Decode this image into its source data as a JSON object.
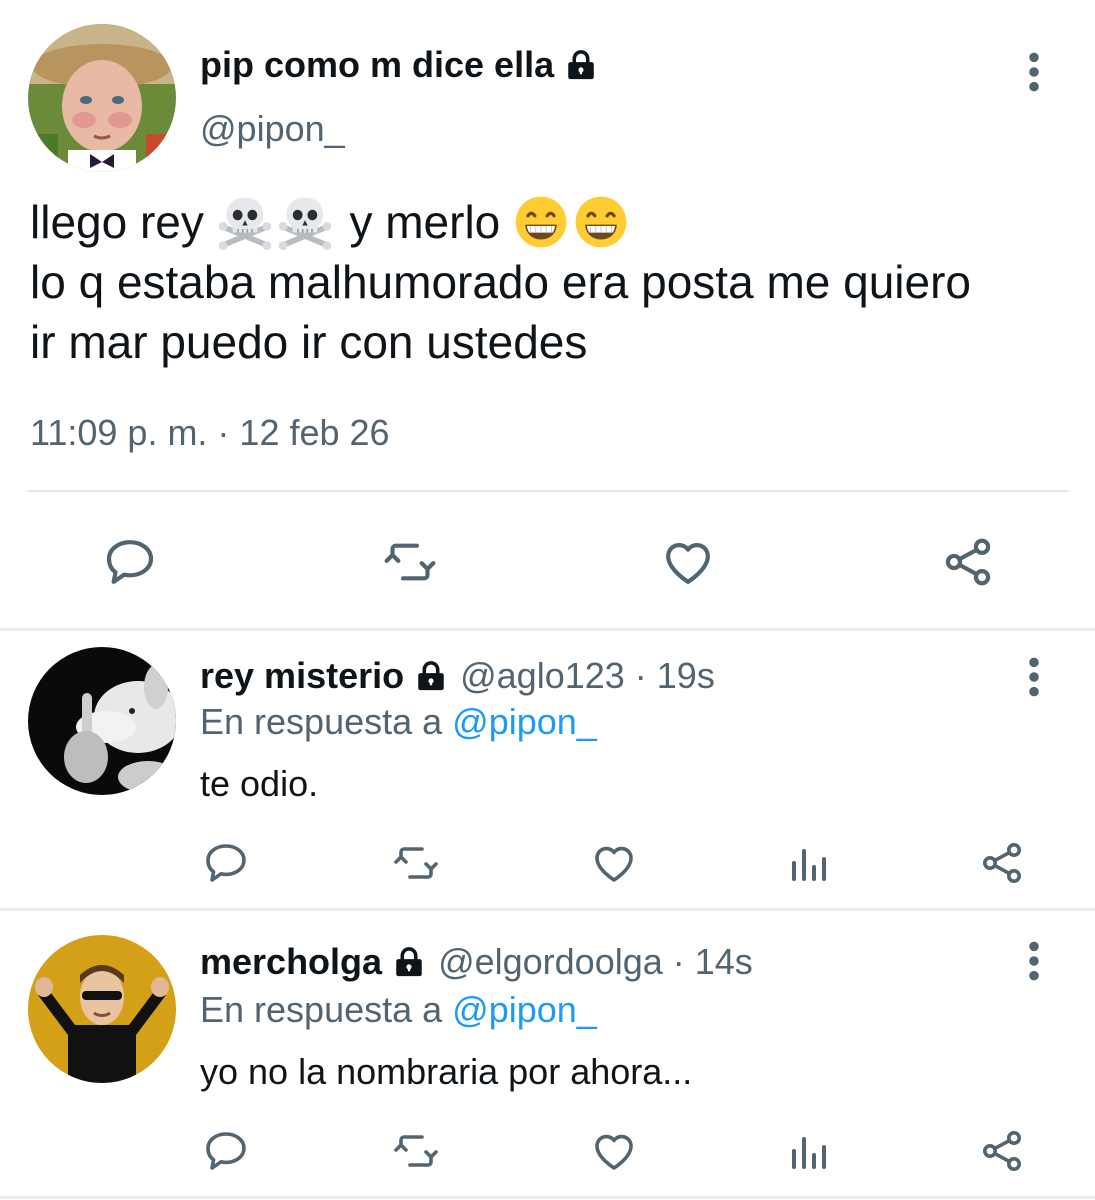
{
  "main_tweet": {
    "display_name": "pip como m dice ella",
    "handle": "@pipon_",
    "text_line1_a": "llego rey",
    "text_line1_b": "y merlo",
    "text_line2": "lo q estaba malhumorado era posta me quiero",
    "text_line3": "ir mar puedo ir con ustedes",
    "emojis_1": [
      "skull-crossbones",
      "skull-crossbones"
    ],
    "emojis_2": [
      "grinning-face",
      "grinning-face"
    ],
    "timestamp": "11:09 p. m. · 12 feb 26",
    "actions": [
      "reply-icon",
      "retweet-icon",
      "like-icon",
      "share-icon"
    ]
  },
  "replies": [
    {
      "display_name": "rey misterio",
      "meta": "@aglo123 · 19s",
      "reply_prefix": "En respuesta a ",
      "reply_mention": "@pipon_",
      "text": "te odio.",
      "actions": [
        "reply-icon",
        "retweet-icon",
        "like-icon",
        "analytics-icon",
        "share-icon"
      ]
    },
    {
      "display_name": "mercholga",
      "meta": "@elgordoolga · 14s",
      "reply_prefix": "En respuesta a ",
      "reply_mention": "@pipon_",
      "text": "yo no la nombraria por ahora...",
      "actions": [
        "reply-icon",
        "retweet-icon",
        "like-icon",
        "analytics-icon",
        "share-icon"
      ]
    }
  ],
  "colors": {
    "text": "#0f1419",
    "secondary": "#536471",
    "link": "#1d9bf0",
    "divider": "#e6ecf0"
  }
}
